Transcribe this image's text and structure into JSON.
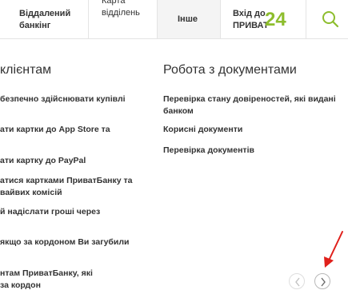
{
  "nav": {
    "remote_banking": "Віддалений\nбанкінг",
    "branch_map": "Карта\nвідділень",
    "other": "Інше",
    "login_text": "Вхід до\nПРИВАТ",
    "login_num": "24",
    "search_icon": "search-icon"
  },
  "left_column": {
    "title": "клієнтам",
    "links": [
      "безпечно здійснювати купівлі",
      "ати картки до App Store та",
      "ати картку до PayPal",
      "атися картками ПриватБанку та\nвайвих комісій",
      "й надіслати гроші через",
      "якщо за кордоном Ви загубили",
      "нтам ПриватБанку, які\nза кордон"
    ]
  },
  "right_column": {
    "title": "Робота з документами",
    "links": [
      "Перевірка стану довіреностей, які видані\nбанком",
      "Корисні документи",
      "Перевірка документів"
    ]
  },
  "carousel": {
    "prev_icon": "chevron-left-icon",
    "next_icon": "chevron-right-icon"
  },
  "colors": {
    "accent_green": "#8dbd2d",
    "annotation_red": "#e0201b",
    "text": "#333333"
  }
}
